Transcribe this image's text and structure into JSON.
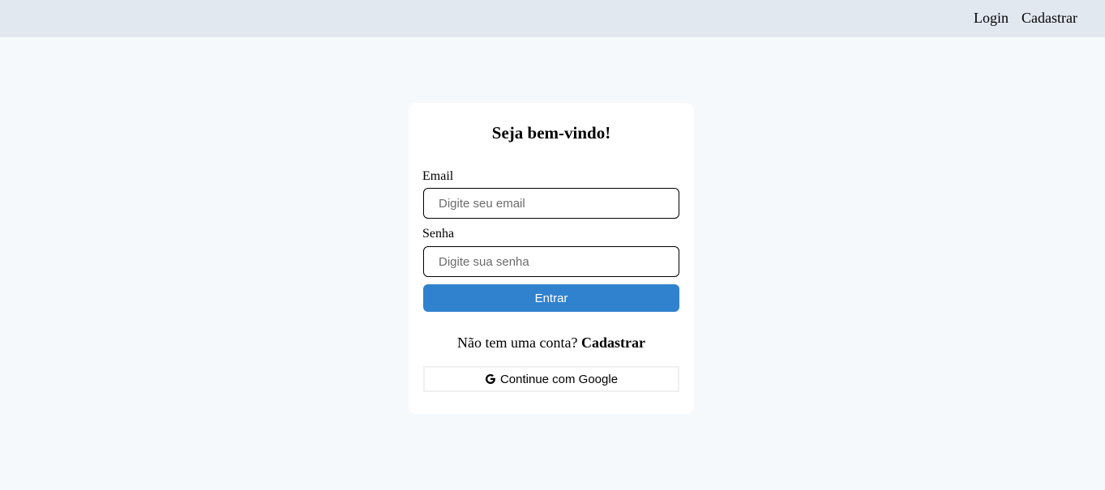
{
  "nav": {
    "login_label": "Login",
    "register_label": "Cadastrar"
  },
  "card": {
    "title": "Seja bem-vindo!",
    "email_label": "Email",
    "email_placeholder": "Digite seu email",
    "email_value": "",
    "password_label": "Senha",
    "password_placeholder": "Digite sua senha",
    "password_value": "",
    "submit_label": "Entrar",
    "no_account_text": "Não tem uma conta?",
    "register_link": "Cadastrar",
    "google_label": "Continue com Google",
    "google_icon": "google-icon"
  },
  "colors": {
    "page_background": "#f5f9fc",
    "topbar_background": "#e2e8f0",
    "primary_button": "#3182ce",
    "card_background": "#ffffff"
  }
}
